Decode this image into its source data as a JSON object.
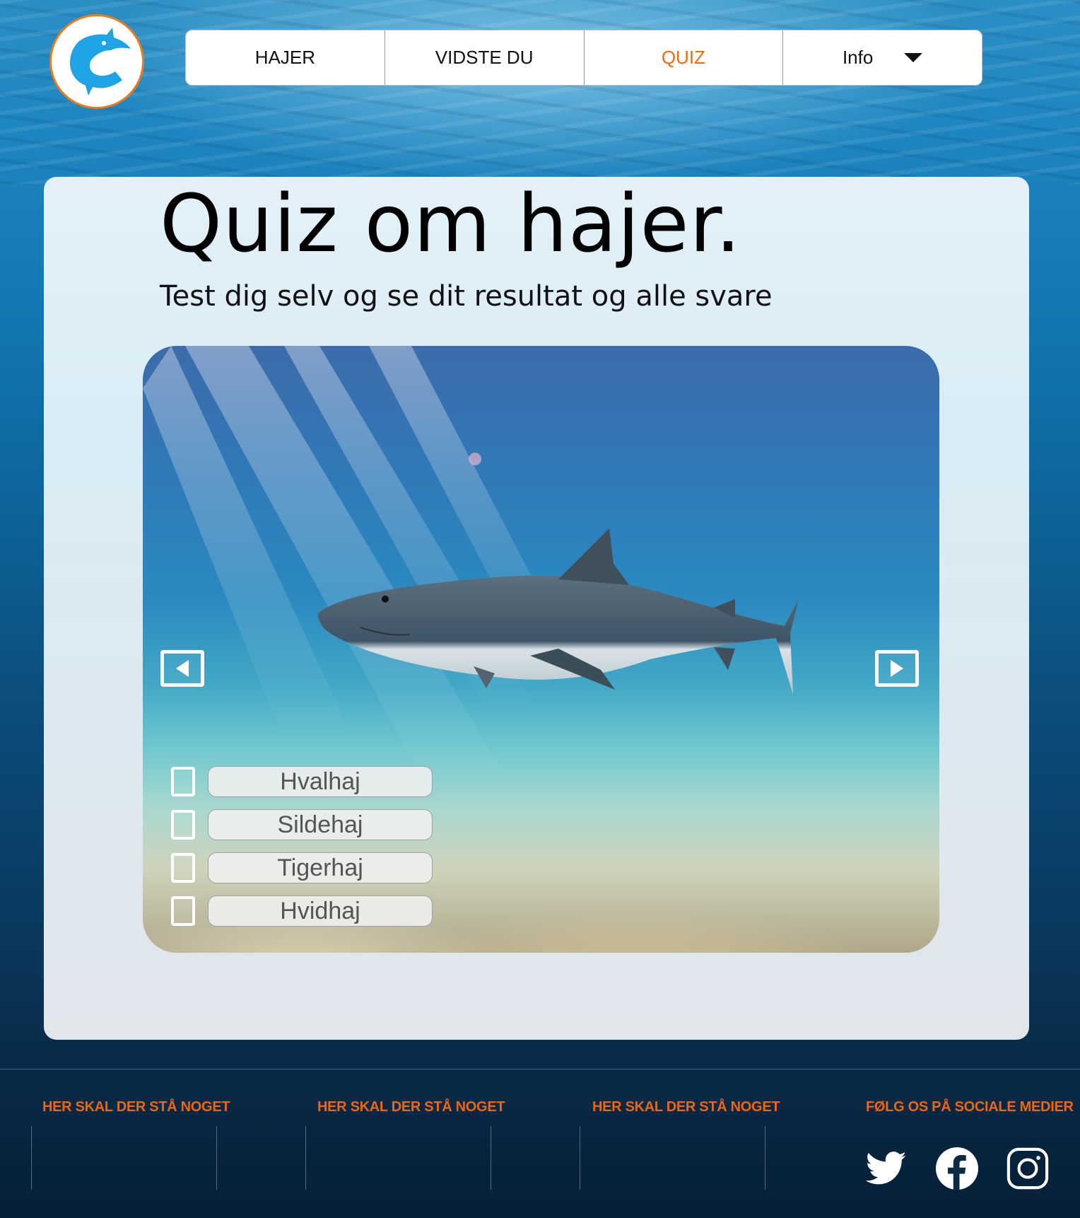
{
  "nav": {
    "items": [
      {
        "label": "HAJER"
      },
      {
        "label": "VIDSTE DU"
      },
      {
        "label": "QUIZ"
      },
      {
        "label": "Info"
      }
    ]
  },
  "colors": {
    "accent": "#f06b12",
    "logo_blue": "#1ea3e6"
  },
  "main": {
    "title": "Quiz om hajer.",
    "subtitle": "Test dig selv og se dit resultat og alle svare",
    "options": [
      {
        "label": "Hvalhaj"
      },
      {
        "label": "Sildehaj"
      },
      {
        "label": "Tigerhaj"
      },
      {
        "label": "Hvidhaj"
      }
    ]
  },
  "footer": {
    "headings": [
      "HER SKAL DER STÅ NOGET",
      "HER SKAL DER STÅ NOGET",
      "HER SKAL DER STÅ NOGET",
      "FØLG OS PÅ SOCIALE MEDIER"
    ],
    "social": [
      "twitter-icon",
      "facebook-icon",
      "instagram-icon"
    ]
  }
}
